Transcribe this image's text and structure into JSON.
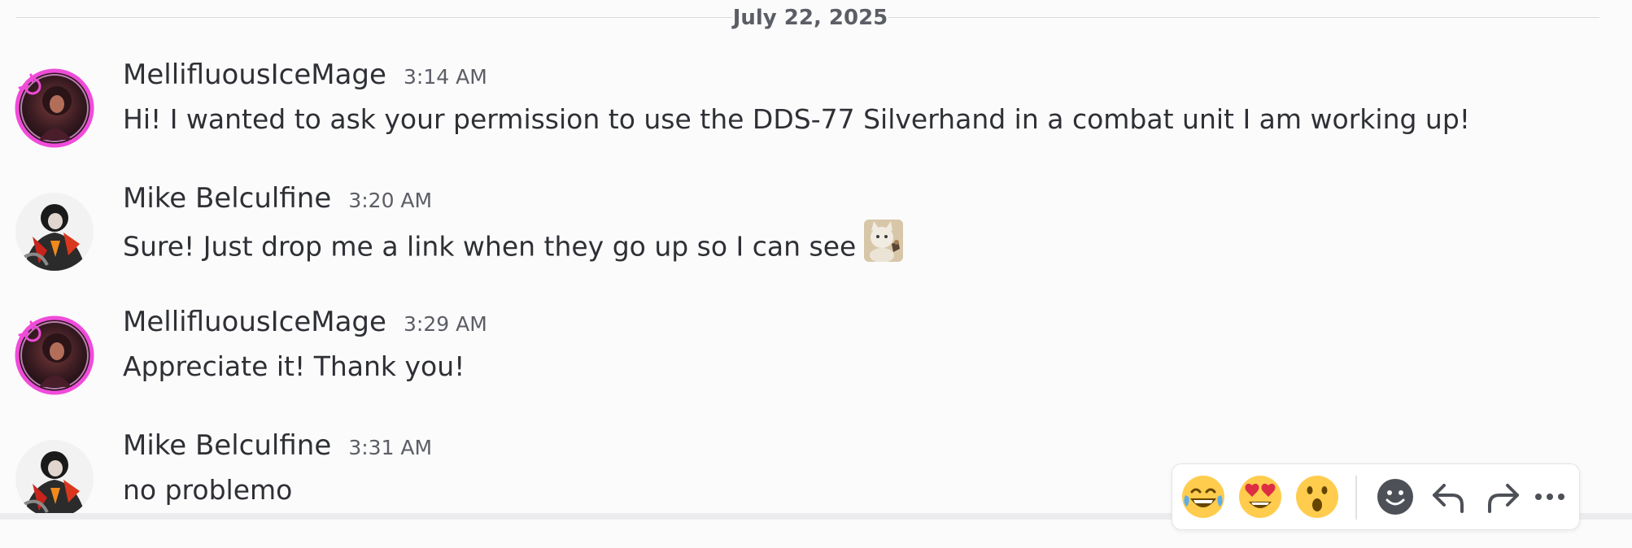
{
  "date_divider": {
    "label": "July 22, 2025"
  },
  "messages": [
    {
      "username": "MellifluousIceMage",
      "time": "3:14 AM",
      "text": "Hi! I wanted to ask your permission to use the DDS-77 Silverhand in a combat unit I am working up!",
      "avatar": "ice-mage-avatar"
    },
    {
      "username": "Mike Belculfine",
      "time": "3:20 AM",
      "text": "Sure! Just drop me a link when they go up so I can see",
      "inline_emoji": "thumbs-up-cat-emoji",
      "avatar": "mike-avatar"
    },
    {
      "username": "MellifluousIceMage",
      "time": "3:29 AM",
      "text": "Appreciate it! Thank you!",
      "avatar": "ice-mage-avatar"
    },
    {
      "username": "Mike Belculfine",
      "time": "3:31 AM",
      "text": "no problemo",
      "avatar": "mike-avatar"
    }
  ],
  "toolbar": {
    "reactions": [
      "😂",
      "😍",
      "😮"
    ],
    "icons": [
      "add-reaction-icon",
      "reply-icon",
      "forward-icon",
      "more-icon"
    ]
  },
  "colors": {
    "background": "#fbfbfb",
    "text": "#2e3035",
    "muted": "#5c5e66",
    "avatar_ring": "#f04bd9"
  }
}
